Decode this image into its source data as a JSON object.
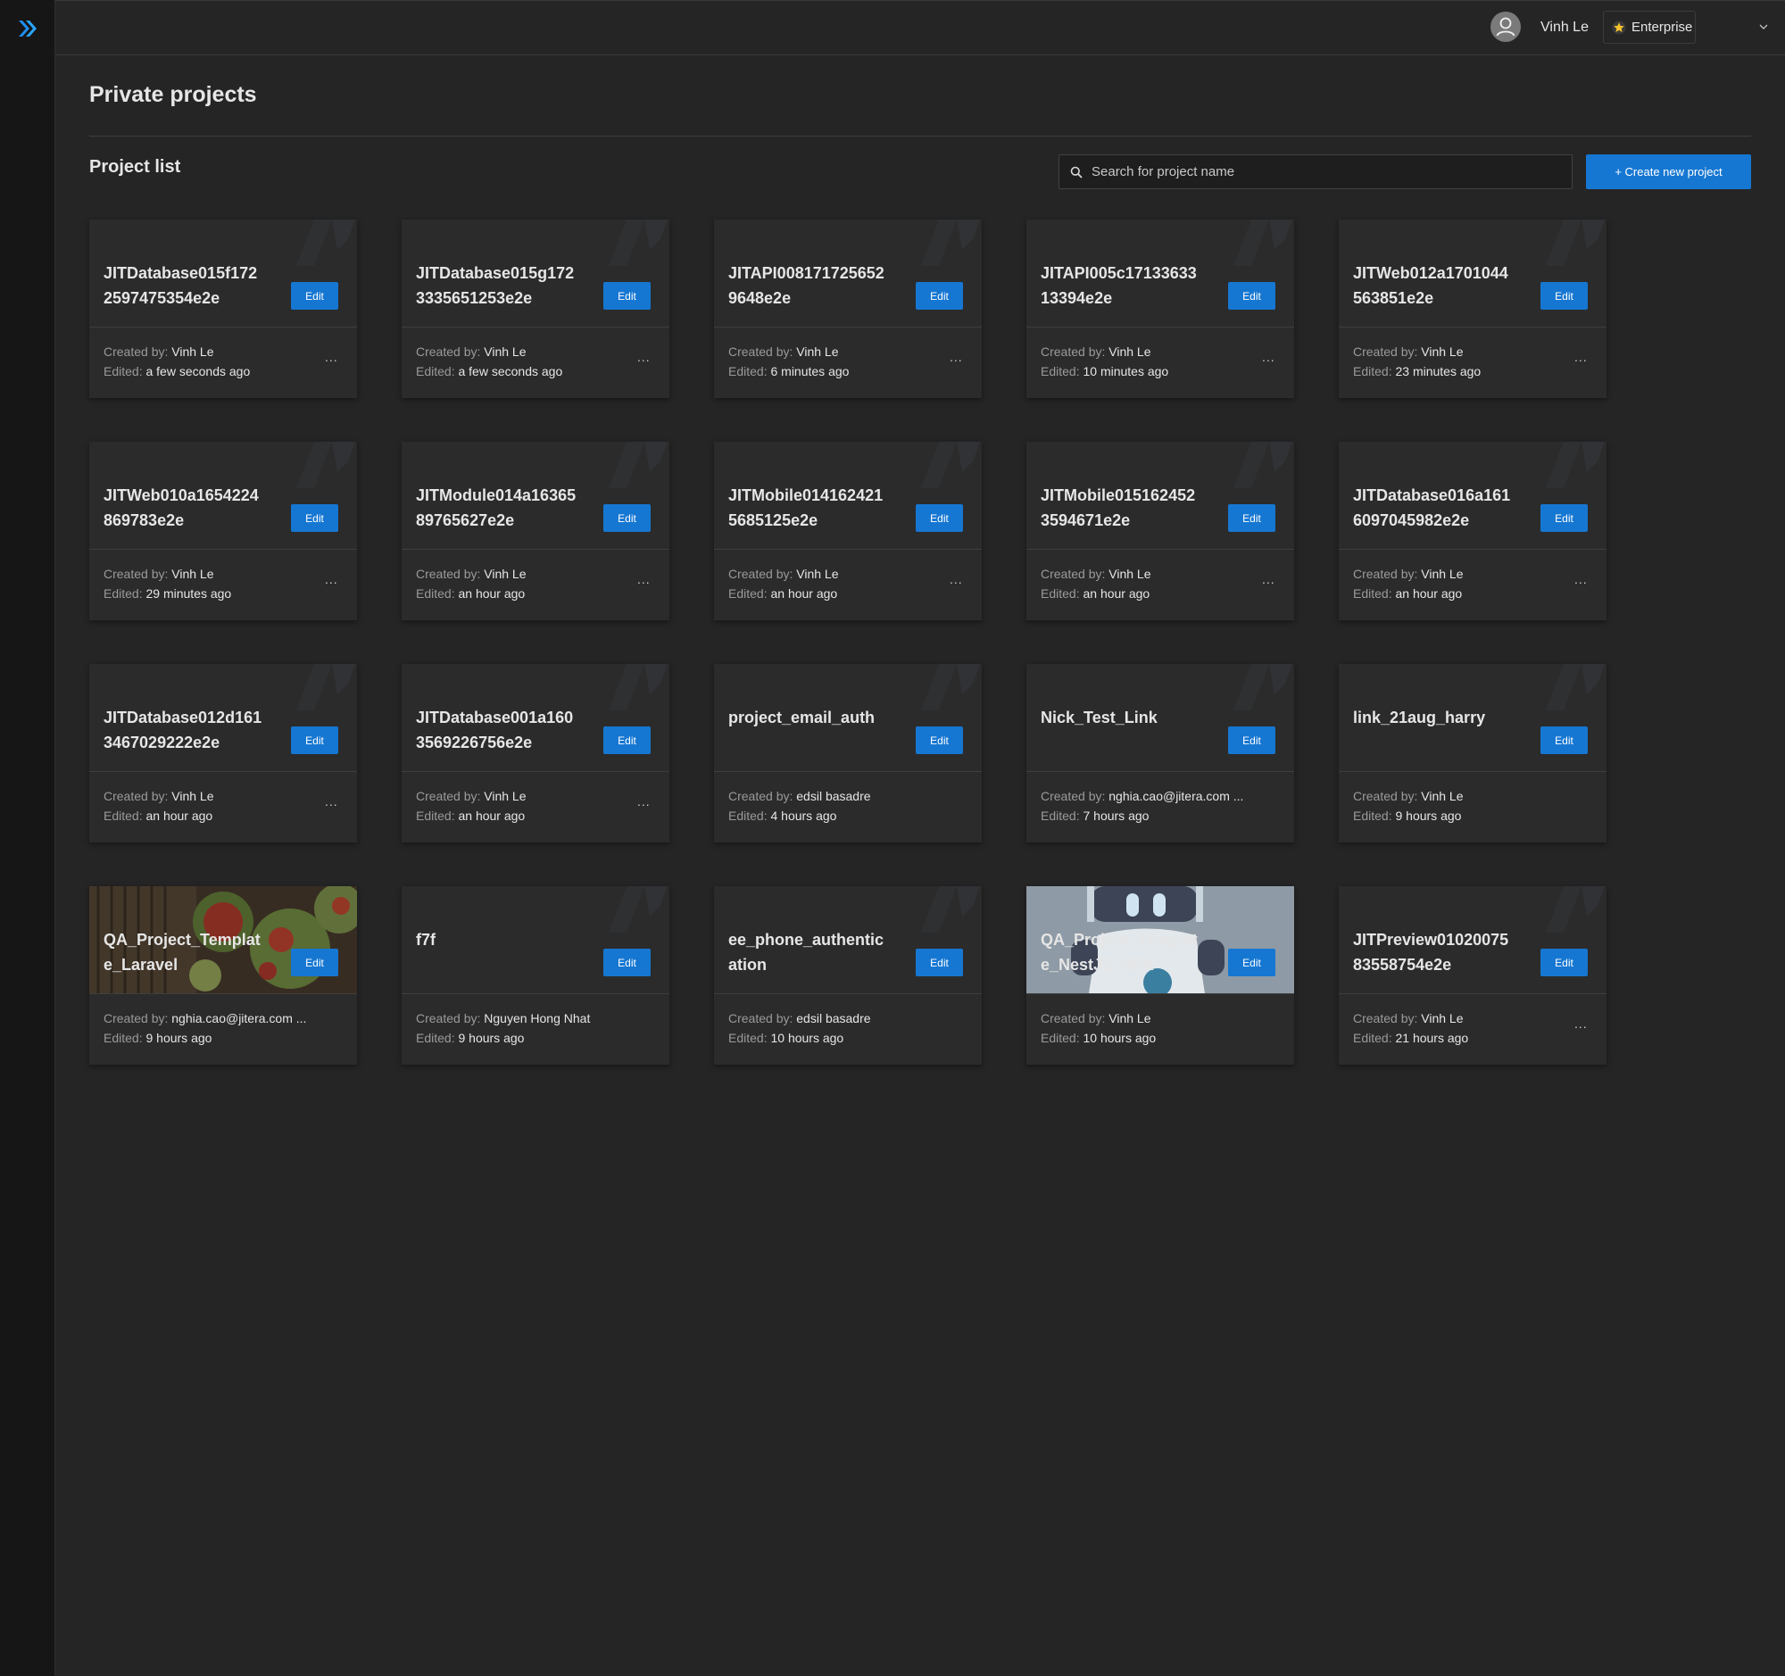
{
  "header": {
    "user_name": "Vinh Le",
    "plan": "Enterprise"
  },
  "page": {
    "title": "Private projects",
    "list_title": "Project list",
    "search_placeholder": "Search for project name",
    "create_label": "+ Create new project",
    "edit_label": "Edit",
    "created_prefix": "Created by:",
    "edited_prefix": "Edited:",
    "more_label": "..."
  },
  "colors": {
    "primary": "#1677d2",
    "background": "#252526",
    "card": "#2b2b2b"
  },
  "projects": [
    {
      "name": "JITDatabase015f1722597475354e2e",
      "created_by": "Vinh Le",
      "edited": "a few seconds ago",
      "more": true,
      "thumbnail": null
    },
    {
      "name": "JITDatabase015g1723335651253e2e",
      "created_by": "Vinh Le",
      "edited": "a few seconds ago",
      "more": true,
      "thumbnail": null
    },
    {
      "name": "JITAPI0081717256529648e2e",
      "created_by": "Vinh Le",
      "edited": "6 minutes ago",
      "more": true,
      "thumbnail": null
    },
    {
      "name": "JITAPI005c1713363313394e2e",
      "created_by": "Vinh Le",
      "edited": "10 minutes ago",
      "more": true,
      "thumbnail": null
    },
    {
      "name": "JITWeb012a1701044563851e2e",
      "created_by": "Vinh Le",
      "edited": "23 minutes ago",
      "more": true,
      "thumbnail": null
    },
    {
      "name": "JITWeb010a1654224869783e2e",
      "created_by": "Vinh Le",
      "edited": "29 minutes ago",
      "more": true,
      "thumbnail": null
    },
    {
      "name": "JITModule014a1636589765627e2e",
      "created_by": "Vinh Le",
      "edited": "an hour ago",
      "more": true,
      "thumbnail": null
    },
    {
      "name": "JITMobile0141624215685125e2e",
      "created_by": "Vinh Le",
      "edited": "an hour ago",
      "more": true,
      "thumbnail": null
    },
    {
      "name": "JITMobile0151624523594671e2e",
      "created_by": "Vinh Le",
      "edited": "an hour ago",
      "more": true,
      "thumbnail": null
    },
    {
      "name": "JITDatabase016a1616097045982e2e",
      "created_by": "Vinh Le",
      "edited": "an hour ago",
      "more": true,
      "thumbnail": null
    },
    {
      "name": "JITDatabase012d1613467029222e2e",
      "created_by": "Vinh Le",
      "edited": "an hour ago",
      "more": true,
      "thumbnail": null
    },
    {
      "name": "JITDatabase001a1603569226756e2e",
      "created_by": "Vinh Le",
      "edited": "an hour ago",
      "more": true,
      "thumbnail": null
    },
    {
      "name": "project_email_auth",
      "created_by": "edsil basadre",
      "edited": "4 hours ago",
      "more": false,
      "thumbnail": null
    },
    {
      "name": "Nick_Test_Link",
      "created_by": "nghia.cao@jitera.com ...",
      "edited": "7 hours ago",
      "more": false,
      "thumbnail": null
    },
    {
      "name": "link_21aug_harry",
      "created_by": "Vinh Le",
      "edited": "9 hours ago",
      "more": false,
      "thumbnail": null
    },
    {
      "name": "QA_Project_Template_Laravel",
      "created_by": "nghia.cao@jitera.com ...",
      "edited": "9 hours ago",
      "more": false,
      "thumbnail": "food-photo"
    },
    {
      "name": "f7f",
      "created_by": "Nguyen Hong Nhat",
      "edited": "9 hours ago",
      "more": false,
      "thumbnail": null
    },
    {
      "name": "ee_phone_authentication",
      "created_by": "edsil basadre",
      "edited": "10 hours ago",
      "more": false,
      "thumbnail": null
    },
    {
      "name": "QA_Project_Template_NestJS_SPA",
      "created_by": "Vinh Le",
      "edited": "10 hours ago",
      "more": false,
      "thumbnail": "robot-illustration"
    },
    {
      "name": "JITPreview0102007583558754e2e",
      "created_by": "Vinh Le",
      "edited": "21 hours ago",
      "more": true,
      "thumbnail": null
    }
  ]
}
